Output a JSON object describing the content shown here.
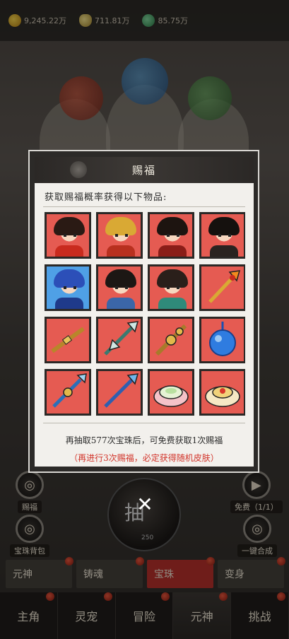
{
  "resources": [
    {
      "icon": "gold-coin-icon",
      "value": "9,245.22万"
    },
    {
      "icon": "gold-ingot-icon",
      "value": "711.81万"
    },
    {
      "icon": "jade-icon",
      "value": "85.75万"
    }
  ],
  "side_buttons": {
    "blessing": "赐福",
    "orb_bag": "宝珠背包",
    "free": "免费（1/1）",
    "one_click": "一键合成"
  },
  "draw": {
    "label": "抽",
    "count": "250"
  },
  "sub_tabs": [
    "元神",
    "铸魂",
    "宝珠",
    "变身"
  ],
  "bottom_nav": [
    "主角",
    "灵宠",
    "冒险",
    "元神",
    "挑战"
  ],
  "modal": {
    "title": "赐福",
    "description": "获取赐福概率获得以下物品:",
    "items": [
      {
        "name": "red-warrior-avatar",
        "kind": "hero"
      },
      {
        "name": "monkey-king-avatar",
        "kind": "hero"
      },
      {
        "name": "third-eye-avatar",
        "kind": "hero"
      },
      {
        "name": "dark-hair-avatar",
        "kind": "hero"
      },
      {
        "name": "dragon-prince-avatar",
        "kind": "hero-blue"
      },
      {
        "name": "armored-general-avatar",
        "kind": "hero"
      },
      {
        "name": "goddess-avatar",
        "kind": "hero"
      },
      {
        "name": "fire-spear-icon",
        "kind": "item"
      },
      {
        "name": "golden-staff-icon",
        "kind": "item"
      },
      {
        "name": "halberd-icon",
        "kind": "item"
      },
      {
        "name": "mace-icon",
        "kind": "item"
      },
      {
        "name": "blue-orb-icon",
        "kind": "item"
      },
      {
        "name": "jade-spear-icon",
        "kind": "item"
      },
      {
        "name": "trident-icon",
        "kind": "item"
      },
      {
        "name": "lotus-seat-icon",
        "kind": "item"
      },
      {
        "name": "cloud-seat-icon",
        "kind": "item"
      }
    ],
    "info_line": "再抽取577次宝珠后，可免费获取1次赐福",
    "hint_line": "（再进行3次赐福，必定获得随机皮肤）"
  },
  "close_label": "✕"
}
